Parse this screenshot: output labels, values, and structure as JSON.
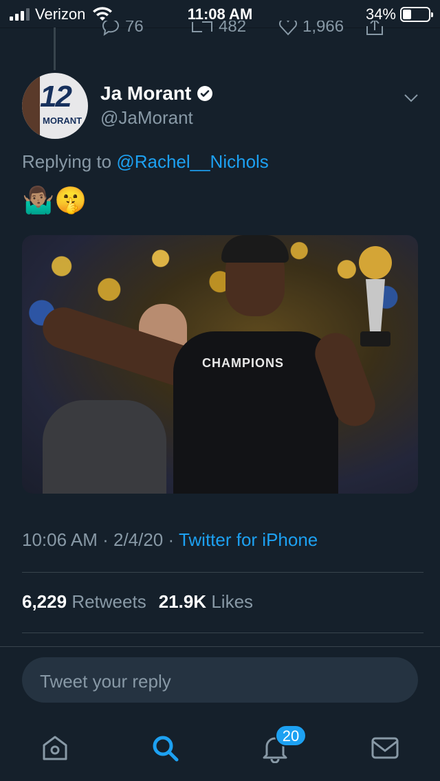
{
  "status_bar": {
    "carrier": "Verizon",
    "time": "11:08 AM",
    "battery_percent_text": "34%",
    "battery_level": 0.34,
    "signal_bars": 3
  },
  "prev_tweet_actions": {
    "replies": "76",
    "retweets": "482",
    "likes": "1,966"
  },
  "tweet": {
    "display_name": "Ja Morant",
    "handle": "@JaMorant",
    "avatar_jersey_number": "12",
    "avatar_jersey_name": "MORANT",
    "replying_prefix": "Replying to",
    "replying_to": "@Rachel__Nichols",
    "text": "🤷🏽‍♂️🤫",
    "media_shirt_text": "CHAMPIONS",
    "time": "10:06 AM",
    "date": "2/4/20",
    "source": "Twitter for iPhone",
    "retweets_count": "6,229",
    "retweets_label": "Retweets",
    "likes_count": "21.9K",
    "likes_label": "Likes"
  },
  "reply_box": {
    "placeholder": "Tweet your reply"
  },
  "tabbar": {
    "notifications_badge": "20"
  },
  "colors": {
    "background": "#15202b",
    "accent": "#1da1f2",
    "secondary_text": "#8899a6",
    "divider": "#38444d"
  }
}
